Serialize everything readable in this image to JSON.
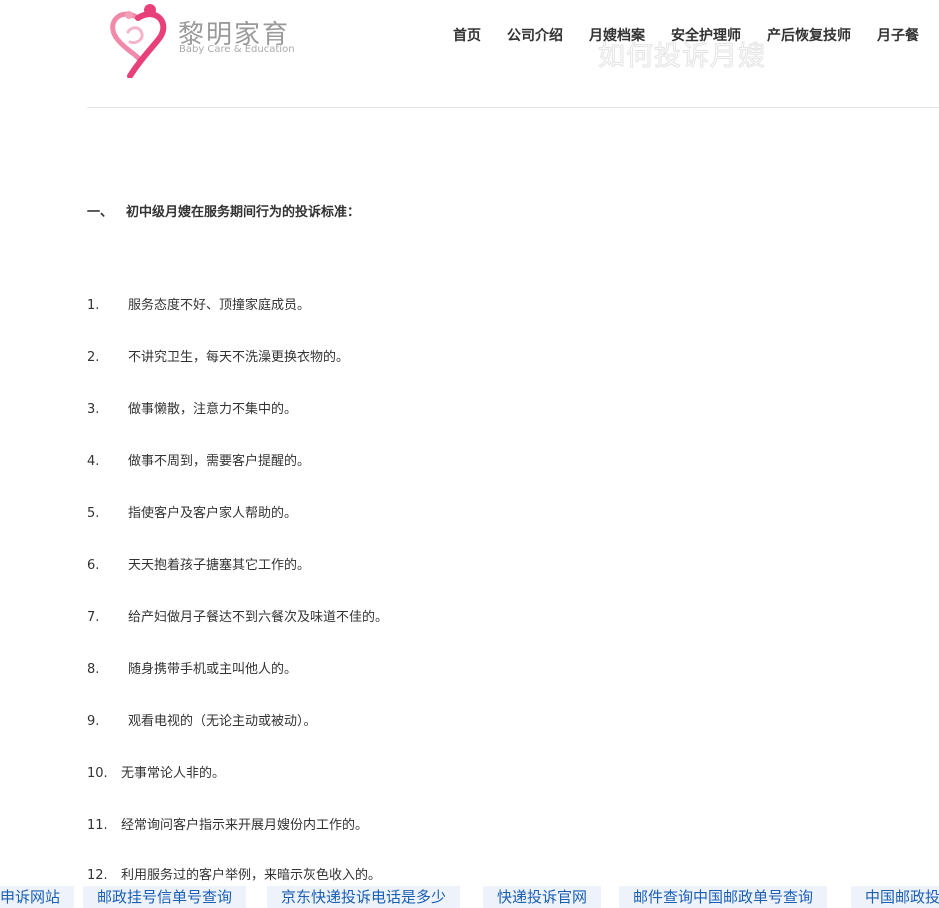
{
  "header": {
    "logo_text_cn": "黎明家育",
    "logo_text_en": "Baby Care & Education",
    "nav": [
      "首页",
      "公司介绍",
      "月嫂档案",
      "安全护理师",
      "产后恢复技师",
      "月子餐"
    ],
    "watermark": "如何投诉月嫂"
  },
  "article": {
    "section_num": "一、",
    "section_title": "初中级月嫂在服务期间行为的投诉标准：",
    "items": [
      {
        "num": "1.",
        "text": "服务态度不好、顶撞家庭成员。"
      },
      {
        "num": "2.",
        "text": "不讲究卫生，每天不洗澡更换衣物的。"
      },
      {
        "num": "3.",
        "text": "做事懒散，注意力不集中的。"
      },
      {
        "num": "4.",
        "text": "做事不周到，需要客户提醒的。"
      },
      {
        "num": "5.",
        "text": "指使客户及客户家人帮助的。"
      },
      {
        "num": "6.",
        "text": "天天抱着孩子搪塞其它工作的。"
      },
      {
        "num": "7.",
        "text": "给产妇做月子餐达不到六餐次及味道不佳的。"
      },
      {
        "num": "8.",
        "text": "随身携带手机或主叫他人的。"
      },
      {
        "num": "9.",
        "text": "观看电视的（无论主动或被动）。"
      },
      {
        "num": "10.",
        "text": "无事常论人非的。"
      },
      {
        "num": "11.",
        "text": "经常询问客户指示来开展月嫂份内工作的。"
      },
      {
        "num": "12.",
        "text": "利用服务过的客户举例，来暗示灰色收入的。"
      }
    ]
  },
  "bottom_links": [
    "申诉网站",
    "邮政挂号信单号查询",
    "京东快递投诉电话是多少",
    "快递投诉官网",
    "邮件查询中国邮政单号查询",
    "中国邮政投"
  ],
  "colors": {
    "logo_pink": "#e8417a",
    "link_blue": "#1a5fb4",
    "link_bg": "#eef3fb"
  }
}
